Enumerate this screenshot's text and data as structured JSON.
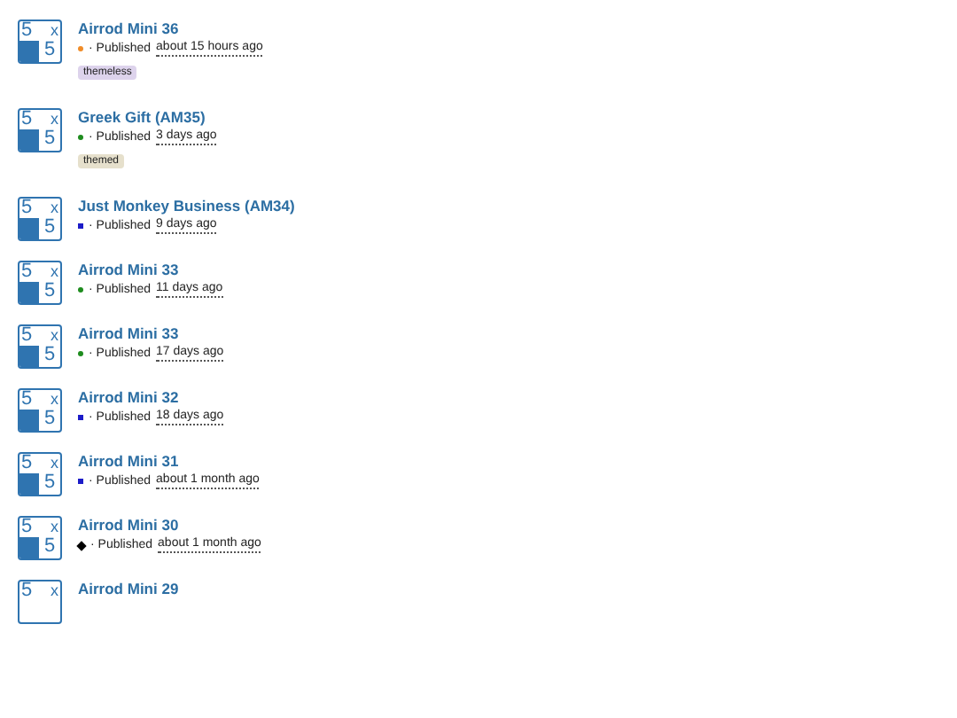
{
  "items": [
    {
      "logo": [
        "5",
        "x",
        "5"
      ],
      "title": "Airrod Mini 36",
      "marker": {
        "kind": "dot",
        "color": "#f08c28"
      },
      "published": "· Published",
      "time": "about 15 hours ago",
      "tag": {
        "label": "themeless",
        "color": "#ddd3ec"
      }
    },
    {
      "logo": [
        "5",
        "x",
        "5"
      ],
      "title": "Greek Gift (AM35)",
      "marker": {
        "kind": "dot",
        "color": "#1e8c1e"
      },
      "published": "· Published",
      "time": "3 days ago",
      "tag": {
        "label": "themed",
        "color": "#e6e0cc"
      }
    },
    {
      "logo": [
        "5",
        "x",
        "5"
      ],
      "title": "Just Monkey Business (AM34)",
      "marker": {
        "kind": "square",
        "color": "#1c1cc8"
      },
      "published": "· Published",
      "time": "9 days ago"
    },
    {
      "logo": [
        "5",
        "x",
        "5"
      ],
      "title": "Airrod Mini 33",
      "marker": {
        "kind": "dot",
        "color": "#1e8c1e"
      },
      "published": "· Published",
      "time": "11 days ago"
    },
    {
      "logo": [
        "5",
        "x",
        "5"
      ],
      "title": "Airrod Mini 33",
      "marker": {
        "kind": "dot",
        "color": "#1e8c1e"
      },
      "published": "· Published",
      "time": "17 days ago"
    },
    {
      "logo": [
        "5",
        "x",
        "5"
      ],
      "title": "Airrod Mini 32",
      "marker": {
        "kind": "square",
        "color": "#1c1cc8"
      },
      "published": "· Published",
      "time": "18 days ago"
    },
    {
      "logo": [
        "5",
        "x",
        "5"
      ],
      "title": "Airrod Mini 31",
      "marker": {
        "kind": "square",
        "color": "#1c1cc8"
      },
      "published": "· Published",
      "time": "about 1 month ago"
    },
    {
      "logo": [
        "5",
        "x",
        "5"
      ],
      "title": "Airrod Mini 30",
      "marker": {
        "kind": "diamond",
        "color": "#000000"
      },
      "published": "· Published",
      "time": "about 1 month ago"
    },
    {
      "logo": [
        "5",
        "x"
      ],
      "title": "Airrod Mini 29"
    }
  ]
}
